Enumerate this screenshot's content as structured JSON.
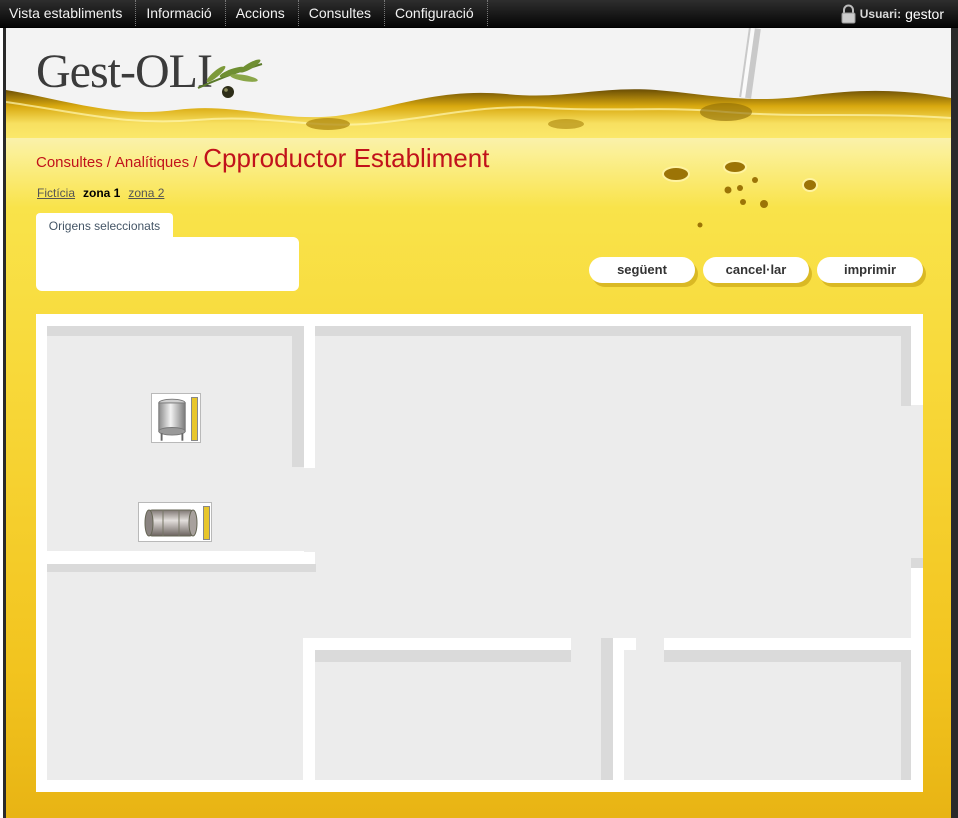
{
  "nav": {
    "items": [
      "Vista establiments",
      "Informació",
      "Accions",
      "Consultes",
      "Configuració"
    ]
  },
  "user": {
    "label": "Usuari:",
    "name": "gestor"
  },
  "logo": {
    "text": "Gest-OLI"
  },
  "breadcrumb": {
    "parts": [
      "Consultes",
      "Analítiques"
    ],
    "current": "Cpproductor Establiment"
  },
  "zones": {
    "items": [
      "Fictícia",
      "zona 1",
      "zona 2"
    ],
    "active_index": 1
  },
  "origins": {
    "tab_label": "Origens seleccionats"
  },
  "buttons": {
    "next": "següent",
    "cancel": "cancel·lar",
    "print": "imprimir"
  },
  "tanks": [
    {
      "kind": "vertical-tank-icon",
      "level": 1.0
    },
    {
      "kind": "horizontal-tank-icon",
      "level": 1.0
    }
  ],
  "colors": {
    "accent_red": "#c1121b",
    "oil_yellow": "#f8d93a",
    "nav_bg": "#111111"
  }
}
